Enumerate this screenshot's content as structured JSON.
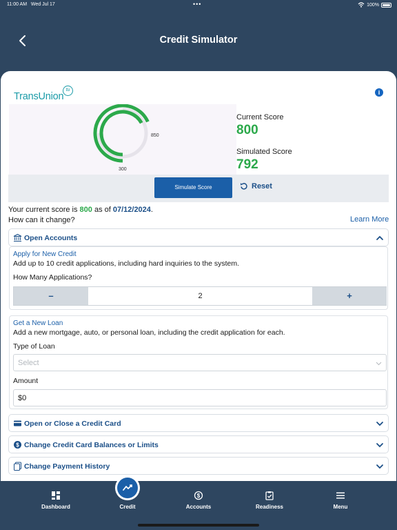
{
  "status": {
    "time": "11:00 AM",
    "date": "Wed Jul 17",
    "battery": "100%"
  },
  "header": {
    "title": "Credit Simulator"
  },
  "brand": {
    "logo_text": "TransUnion",
    "logo_badge": "tu"
  },
  "gauge": {
    "min_label": "300",
    "max_label": "850",
    "min": 300,
    "max": 850,
    "current": 800,
    "simulated": 792,
    "color": "#2ca94b"
  },
  "scores": {
    "current_label": "Current Score",
    "current_value": "800",
    "simulated_label": "Simulated Score",
    "simulated_value": "792"
  },
  "actions": {
    "simulate_label": "Simulate Score",
    "reset_label": "Reset"
  },
  "summary": {
    "prefix": "Your current score is ",
    "score": "800",
    "middle": " as of ",
    "date": "07/12/2024",
    "suffix": ".",
    "question": "How can it change?",
    "learn_more": "Learn More"
  },
  "open_accounts": {
    "label": "Open Accounts",
    "new_credit": {
      "title": "Apply for New Credit",
      "description": "Add up to 10 credit applications, including hard inquiries to the system.",
      "question": "How Many Applications?",
      "minus": "–",
      "value": "2",
      "plus": "+"
    },
    "new_loan": {
      "title": "Get a New Loan",
      "description": "Add a new mortgage, auto, or personal loan, including the credit application for each.",
      "type_label": "Type of Loan",
      "type_placeholder": "Select",
      "amount_label": "Amount",
      "amount_value": "$0"
    }
  },
  "sections": [
    {
      "label": "Open or Close a Credit Card"
    },
    {
      "label": "Change Credit Card Balances or Limits"
    },
    {
      "label": "Change Payment History"
    }
  ],
  "nav": [
    {
      "label": "Dashboard"
    },
    {
      "label": "Credit"
    },
    {
      "label": "Accounts"
    },
    {
      "label": "Readiness"
    },
    {
      "label": "Menu"
    }
  ],
  "colors": {
    "brand_blue": "#1b4f88",
    "accent_green": "#2ca94b",
    "nav_bg": "#2e4660"
  }
}
